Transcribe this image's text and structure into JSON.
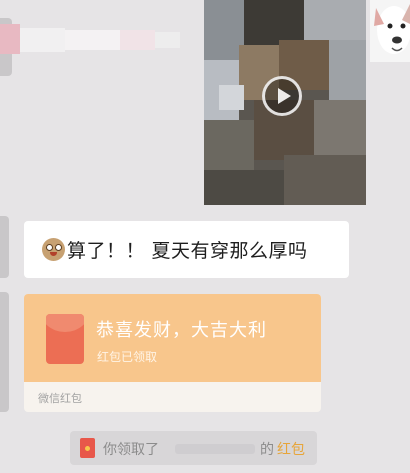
{
  "chat": {
    "text_message": "算了！！ 夏天有穿那么厚吗",
    "red_packet": {
      "title": "恭喜发财，大吉大利",
      "status": "红包已领取",
      "footer": "微信红包"
    },
    "notice": {
      "prefix": "你领取了",
      "suffix": "的",
      "link": "红包"
    }
  },
  "icons": {
    "emoji": "grinning-emoji-icon",
    "play": "play-icon",
    "red_packet": "red-envelope-icon",
    "notice": "red-envelope-small-icon"
  },
  "colors": {
    "background": "#e6e4e6",
    "bubble": "#ffffff",
    "red_packet": "#f8c68c",
    "link": "#e7a53a"
  }
}
